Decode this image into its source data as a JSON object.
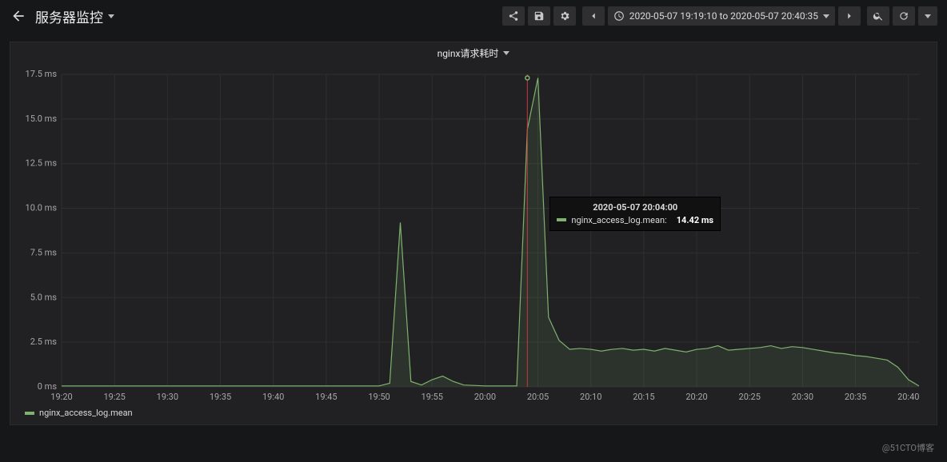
{
  "header": {
    "dashboard_title": "服务器监控",
    "timerange_label": "2020-05-07 19:19:10 to 2020-05-07 20:40:35"
  },
  "panel": {
    "title": "nginx请求耗时",
    "legend_series": "nginx_access_log.mean"
  },
  "tooltip": {
    "time": "2020-05-07 20:04:00",
    "series_label": "nginx_access_log.mean:",
    "value": "14.42 ms"
  },
  "watermark": "@51CTO博客",
  "chart_data": {
    "type": "line",
    "title": "nginx请求耗时",
    "xlabel": "",
    "ylabel": "ms",
    "ylim": [
      0,
      17.5
    ],
    "y_ticks": [
      "0 ms",
      "2.5 ms",
      "5.0 ms",
      "7.5 ms",
      "10.0 ms",
      "12.5 ms",
      "15.0 ms",
      "17.5 ms"
    ],
    "x_ticks": [
      "19:20",
      "19:25",
      "19:30",
      "19:35",
      "19:40",
      "19:45",
      "19:50",
      "19:55",
      "20:00",
      "20:05",
      "20:10",
      "20:15",
      "20:20",
      "20:25",
      "20:30",
      "20:35",
      "20:40"
    ],
    "x_range_minutes": [
      1160,
      1241
    ],
    "hover_x_minute": 1204,
    "series": [
      {
        "name": "nginx_access_log.mean",
        "color": "#7eb26d",
        "x_minutes": [
          1160,
          1165,
          1170,
          1175,
          1180,
          1185,
          1190,
          1191,
          1192,
          1193,
          1194,
          1195,
          1196,
          1197,
          1198,
          1200,
          1203,
          1204,
          1205,
          1206,
          1207,
          1208,
          1209,
          1210,
          1211,
          1212,
          1213,
          1214,
          1215,
          1216,
          1217,
          1218,
          1219,
          1220,
          1221,
          1222,
          1223,
          1224,
          1225,
          1226,
          1227,
          1228,
          1229,
          1230,
          1231,
          1232,
          1233,
          1234,
          1235,
          1236,
          1237,
          1238,
          1239,
          1240,
          1241
        ],
        "y": [
          0.05,
          0.05,
          0.05,
          0.05,
          0.05,
          0.05,
          0.05,
          0.2,
          9.2,
          0.3,
          0.1,
          0.4,
          0.6,
          0.3,
          0.1,
          0.05,
          0.05,
          14.42,
          17.3,
          3.9,
          2.6,
          2.1,
          2.15,
          2.1,
          2.0,
          2.1,
          2.15,
          2.05,
          2.1,
          2.0,
          2.15,
          2.05,
          1.95,
          2.1,
          2.15,
          2.3,
          2.05,
          2.1,
          2.15,
          2.2,
          2.3,
          2.15,
          2.25,
          2.2,
          2.1,
          2.0,
          1.9,
          1.85,
          1.75,
          1.7,
          1.6,
          1.5,
          1.1,
          0.4,
          0.05
        ]
      }
    ]
  }
}
